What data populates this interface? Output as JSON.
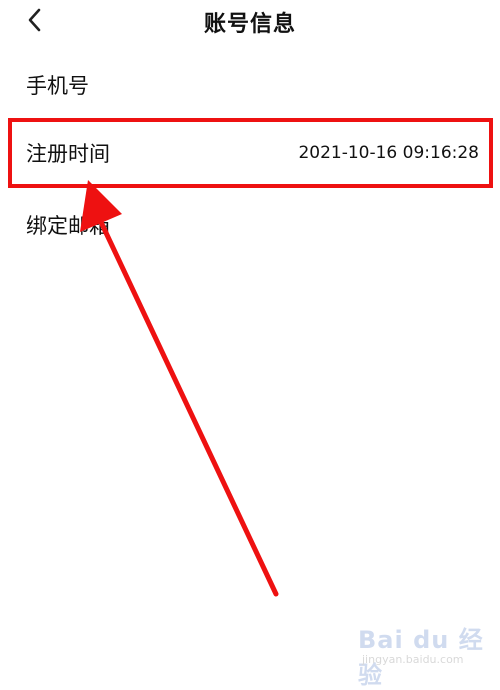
{
  "header": {
    "title": "账号信息",
    "back_icon": "chevron-left-icon"
  },
  "rows": [
    {
      "label": "手机号",
      "value": ""
    },
    {
      "label": "注册时间",
      "value": "2021-10-16  09:16:28",
      "highlighted": true
    },
    {
      "label": "绑定邮箱",
      "value": ""
    }
  ],
  "annotation": {
    "highlight_color": "#ee1111",
    "arrow_color": "#ee1111"
  },
  "watermark": {
    "mark": "Bai du 经验",
    "sub": "jingyan.baidu.com"
  }
}
